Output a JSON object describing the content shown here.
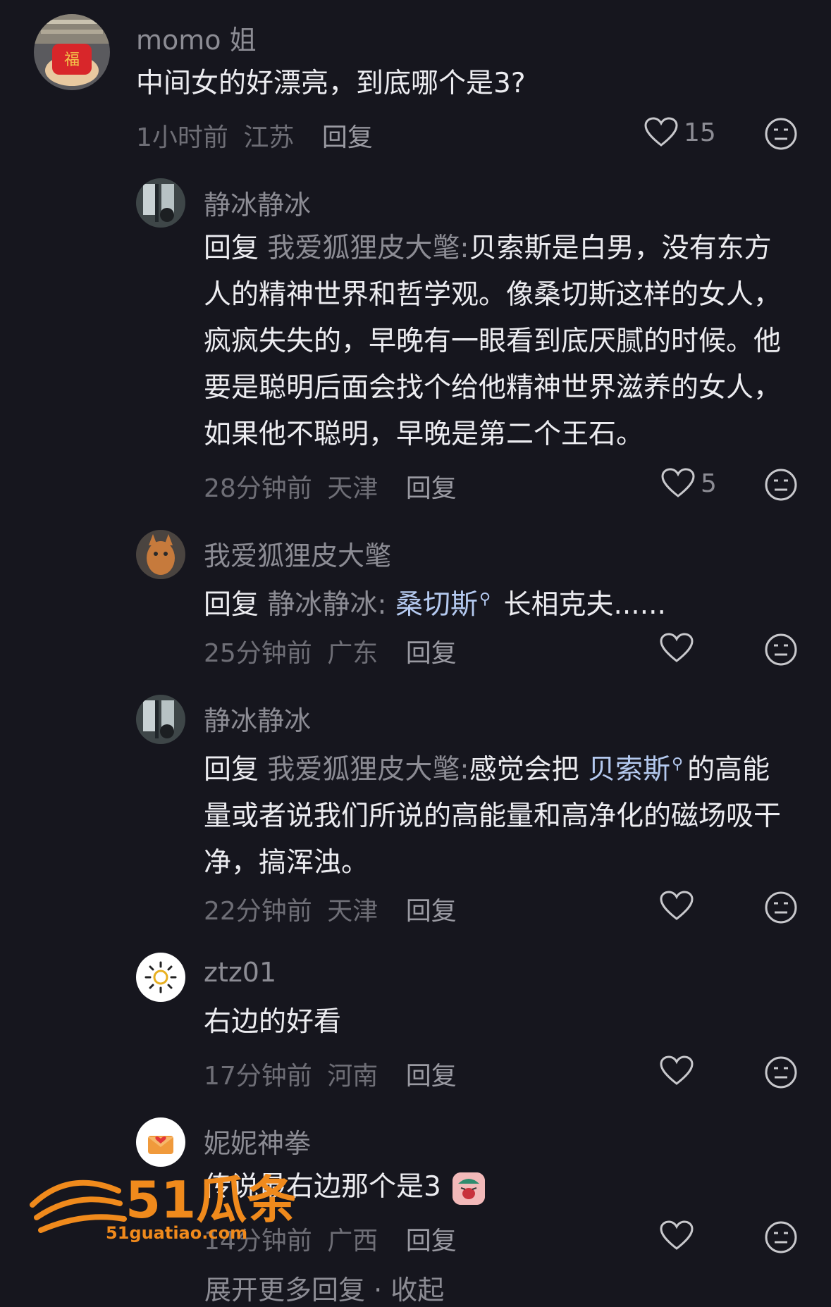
{
  "comments": [
    {
      "name": "momo 姐",
      "text": "中间女的好漂亮，到底哪个是3?",
      "time": "1小时前",
      "location": "江苏",
      "reply_label": "回复",
      "likes": "15"
    },
    {
      "name": "静冰静冰",
      "reply_prefix": "回复",
      "reply_to": "我爱狐狸皮大氅:",
      "text": "贝索斯是白男，没有东方人的精神世界和哲学观。像桑切斯这样的女人，疯疯失失的，早晚有一眼看到底厌腻的时候。他要是聪明后面会找个给他精神世界滋养的女人，如果他不聪明，早晚是第二个王石。",
      "time": "28分钟前",
      "location": "天津",
      "reply_label": "回复",
      "likes": "5"
    },
    {
      "name": "我爱狐狸皮大氅",
      "reply_prefix": "回复",
      "reply_to": "静冰静冰:",
      "link": "桑切斯",
      "text": "长相克夫......",
      "time": "25分钟前",
      "location": "广东",
      "reply_label": "回复",
      "likes": ""
    },
    {
      "name": "静冰静冰",
      "reply_prefix": "回复",
      "reply_to": "我爱狐狸皮大氅:",
      "text_before": "感觉会把",
      "link": "贝索斯",
      "text": "的高能量或者说我们所说的高能量和高净化的磁场吸干净，搞浑浊。",
      "time": "22分钟前",
      "location": "天津",
      "reply_label": "回复",
      "likes": ""
    },
    {
      "name": "ztz01",
      "text": "右边的好看",
      "time": "17分钟前",
      "location": "河南",
      "reply_label": "回复",
      "likes": ""
    },
    {
      "name": "妮妮神拳",
      "text": "传说最右边那个是3",
      "time": "14分钟前",
      "location": "广西",
      "reply_label": "回复",
      "likes": ""
    }
  ],
  "footer": {
    "text": "展开更多回复 · 收起"
  },
  "watermark": {
    "text": "51瓜条",
    "url": "51guatiao.com"
  },
  "colors": {
    "background": "#16161e",
    "text": "#ececf0",
    "muted": "#8c8c94",
    "link": "#b4c9ef",
    "watermark": "#f08a1c"
  }
}
